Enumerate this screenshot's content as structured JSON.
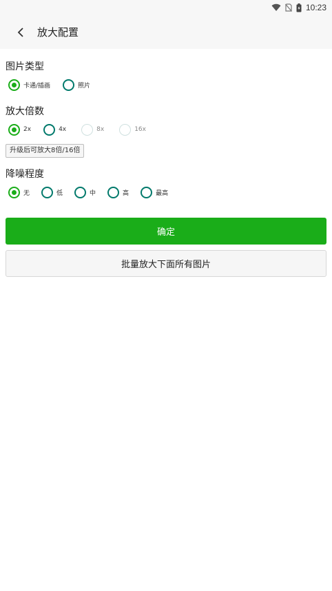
{
  "status_bar": {
    "time": "10:23"
  },
  "app_bar": {
    "title": "放大配置"
  },
  "image_type": {
    "title": "图片类型",
    "options": [
      {
        "label": "卡通/插画",
        "checked": true
      },
      {
        "label": "照片",
        "checked": false
      }
    ]
  },
  "scale": {
    "title": "放大倍数",
    "options": [
      {
        "label": "2x",
        "checked": true
      },
      {
        "label": "4x",
        "checked": false
      },
      {
        "label": "8x",
        "checked": false,
        "disabled": true
      },
      {
        "label": "16x",
        "checked": false,
        "disabled": true
      }
    ],
    "upgrade_label": "升级后可放大8倍/16倍"
  },
  "denoise": {
    "title": "降噪程度",
    "options": [
      {
        "label": "无",
        "checked": true
      },
      {
        "label": "低",
        "checked": false
      },
      {
        "label": "中",
        "checked": false
      },
      {
        "label": "高",
        "checked": false
      },
      {
        "label": "最高",
        "checked": false
      }
    ]
  },
  "actions": {
    "confirm_label": "确定",
    "batch_label": "批量放大下面所有图片"
  },
  "colors": {
    "accent": "#1aad19",
    "radio_unchecked": "#00796b",
    "bar_bg": "#f7f7f7"
  }
}
